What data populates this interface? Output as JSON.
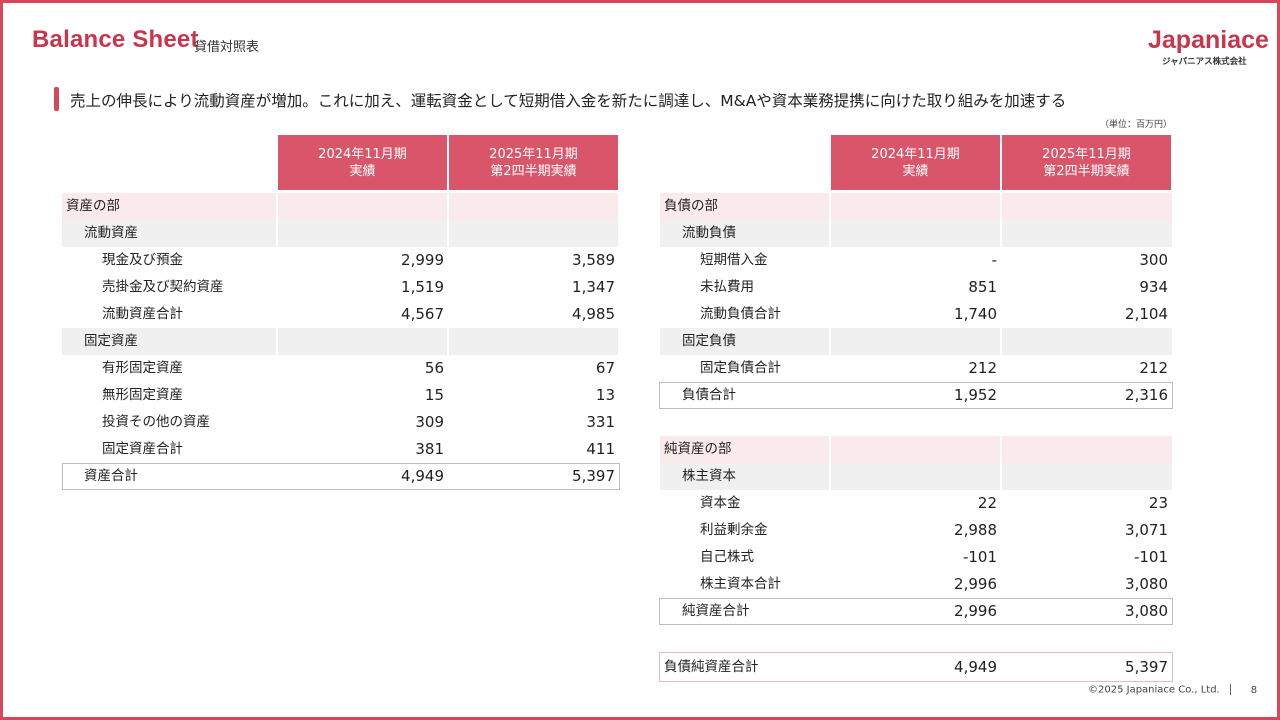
{
  "header": {
    "title": "Balance Sheet",
    "subtitle": "貸借対照表",
    "logo": "Japaniace",
    "logo_sub": "ジャパニアス株式会社"
  },
  "headline": "売上の伸長により流動資産が増加。これに加え、運転資金として短期借入金を新たに調達し、M&Aや資本業務提携に向けた取り組みを加速する",
  "unit": "（単位：百万円）",
  "columns": {
    "col1_line1": "2024年11月期",
    "col1_line2": "実績",
    "col2_line1": "2025年11月期",
    "col2_line2": "第2四半期実績"
  },
  "assets": {
    "section": "資産の部",
    "current": "流動資産",
    "cash": {
      "label": "現金及び預金",
      "v1": "2,999",
      "v2": "3,589"
    },
    "receivables": {
      "label": "売掛金及び契約資産",
      "v1": "1,519",
      "v2": "1,347"
    },
    "current_total": {
      "label": "流動資産合計",
      "v1": "4,567",
      "v2": "4,985"
    },
    "fixed": "固定資産",
    "tangible": {
      "label": "有形固定資産",
      "v1": "56",
      "v2": "67"
    },
    "intangible": {
      "label": "無形固定資産",
      "v1": "15",
      "v2": "13"
    },
    "investments": {
      "label": "投資その他の資産",
      "v1": "309",
      "v2": "331"
    },
    "fixed_total": {
      "label": "固定資産合計",
      "v1": "381",
      "v2": "411"
    },
    "total": {
      "label": "資産合計",
      "v1": "4,949",
      "v2": "5,397"
    }
  },
  "liabilities": {
    "section": "負債の部",
    "current": "流動負債",
    "short_loans": {
      "label": "短期借入金",
      "v1": "-",
      "v2": "300"
    },
    "accrued": {
      "label": "未払費用",
      "v1": "851",
      "v2": "934"
    },
    "current_total": {
      "label": "流動負債合計",
      "v1": "1,740",
      "v2": "2,104"
    },
    "fixed": "固定負債",
    "fixed_total": {
      "label": "固定負債合計",
      "v1": "212",
      "v2": "212"
    },
    "total": {
      "label": "負債合計",
      "v1": "1,952",
      "v2": "2,316"
    }
  },
  "net_assets": {
    "section": "純資産の部",
    "equity": "株主資本",
    "capital": {
      "label": "資本金",
      "v1": "22",
      "v2": "23"
    },
    "retained": {
      "label": "利益剰余金",
      "v1": "2,988",
      "v2": "3,071"
    },
    "treasury": {
      "label": "自己株式",
      "v1": "-101",
      "v2": "-101"
    },
    "equity_total": {
      "label": "株主資本合計",
      "v1": "2,996",
      "v2": "3,080"
    },
    "total": {
      "label": "純資産合計",
      "v1": "2,996",
      "v2": "3,080"
    }
  },
  "grand_total": {
    "label": "負債純資産合計",
    "v1": "4,949",
    "v2": "5,397"
  },
  "footer": {
    "copyright": "©2025 Japaniace Co., Ltd.",
    "page": "8"
  },
  "colors": {
    "accent": "#d9455a",
    "header_bg": "#d9566a",
    "section_bg": "#fbeaec",
    "subsection_bg": "#f0f0f0"
  }
}
